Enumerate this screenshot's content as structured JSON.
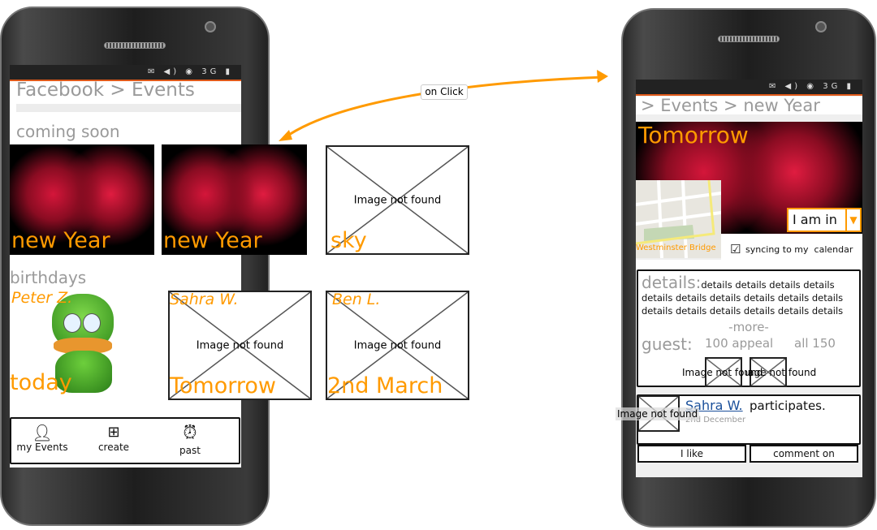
{
  "status_icons": [
    "mail-icon",
    "volume-icon",
    "signal-icon",
    "3g-icon",
    "battery-icon"
  ],
  "left_screen": {
    "breadcrumb": "Facebook > Events",
    "coming_soon": "coming soon",
    "events": [
      {
        "label": "new Year",
        "image": "fireworks"
      },
      {
        "label": "new Year",
        "image": "fireworks"
      },
      {
        "label": "sky",
        "image": "Image not found"
      }
    ],
    "birthdays_title": "birthdays",
    "birthdays": [
      {
        "name": "Peter Z.",
        "date": "today",
        "image": "duck-avatar"
      },
      {
        "name": "Sahra W.",
        "date": "Tomorrow",
        "image": "Image not found"
      },
      {
        "name": "Ben L.",
        "date": "2nd March",
        "image": "Image not found"
      }
    ],
    "nav": [
      {
        "label": "my Events",
        "icon": "user-icon"
      },
      {
        "label": "create",
        "icon": "create-icon"
      },
      {
        "label": "past",
        "icon": "alarm-clock-icon"
      }
    ]
  },
  "connector": {
    "label": "on Click",
    "color": "#ff9a00"
  },
  "right_screen": {
    "breadcrumb": "> Events > new Year",
    "when": "Tomorrow",
    "map_label": "Westminster Bridge",
    "rsvp": "I am in",
    "sync_checked": true,
    "sync_label": "syncing to my  calendar",
    "details_label": "details:",
    "details_text": "details details details details details details details details details details details details details details details details",
    "more": "-more-",
    "guest_label": "guest:",
    "guest_appeal": "100 appeal",
    "guest_all": "all 150",
    "guest_images": [
      "Image not found",
      "Image not found"
    ],
    "post": {
      "image": "Image not found",
      "name": "Sahra W.",
      "action": "participates.",
      "date": "2nd December"
    },
    "like_button": "I like",
    "comment_button": "comment on"
  },
  "colors": {
    "accent": "#ff9a00",
    "text_gray": "#9a9a9a",
    "link": "#1a4f9a",
    "status_line": "#e05a1a"
  }
}
